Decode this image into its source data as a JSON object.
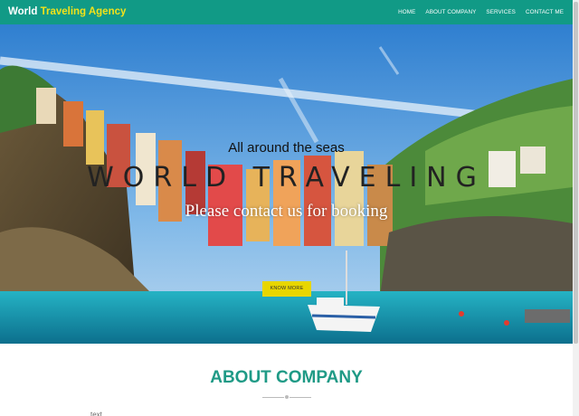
{
  "nav": {
    "brand_first": "World",
    "brand_second": "Traveling Agency",
    "items": [
      "HOME",
      "ABOUT COMPANY",
      "SERVICES",
      "CONTACT ME"
    ]
  },
  "hero": {
    "tagline": "All around the seas",
    "headline": "WORLD TRAVELING",
    "subheadline": "Please contact us for booking",
    "button_label": "KNOW MORE"
  },
  "about": {
    "title": "ABOUT COMPANY",
    "text_partial": "text"
  },
  "colors": {
    "nav_bg": "#119a86",
    "brand_accent": "#f2e21a",
    "button_bg": "#e8d600",
    "about_title": "#1f9a86"
  }
}
